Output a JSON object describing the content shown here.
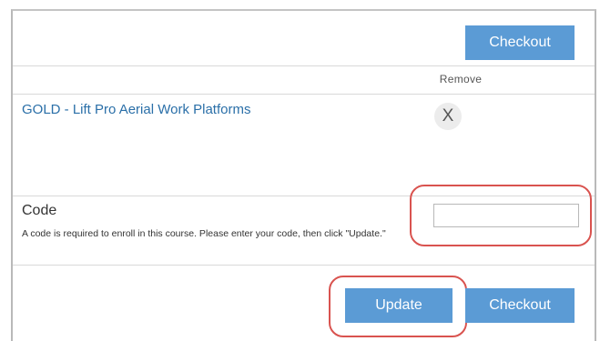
{
  "cart": {
    "checkout_label": "Checkout",
    "remove_header": "Remove",
    "course_title": "GOLD - Lift Pro Aerial Work Platforms",
    "remove_symbol": "X"
  },
  "code_section": {
    "label": "Code",
    "help_text": "A code is required to enroll in this course. Please enter your code, then click \"Update.\"",
    "input_value": "",
    "input_placeholder": ""
  },
  "actions": {
    "update_label": "Update",
    "checkout_label": "Checkout"
  },
  "colors": {
    "button_blue": "#5b9bd5",
    "link_blue": "#2a6fa8",
    "highlight_red": "#d9534f"
  }
}
